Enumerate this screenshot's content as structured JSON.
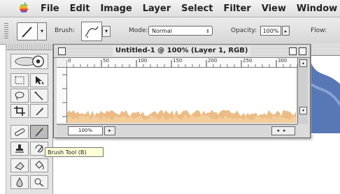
{
  "menubar": {
    "apple_icon": "apple-logo-icon",
    "items": [
      {
        "label": "File"
      },
      {
        "label": "Edit"
      },
      {
        "label": "Image"
      },
      {
        "label": "Layer"
      },
      {
        "label": "Select"
      },
      {
        "label": "Filter"
      },
      {
        "label": "View"
      },
      {
        "label": "Window"
      }
    ]
  },
  "options_bar": {
    "tool_preset_icon": "brush-icon",
    "brush_label": "Brush:",
    "mode_label": "Mode:",
    "mode_value": "Normal",
    "opacity_label": "Opacity:",
    "opacity_value": "100%",
    "flow_label": "Flow:"
  },
  "document": {
    "title": "Untitled-1 @ 100% (Layer 1, RGB)",
    "zoom_value": "100%",
    "ruler_numbers": [
      "0",
      "50",
      "100",
      "150",
      "200",
      "250",
      "300"
    ]
  },
  "tooltip": {
    "text": "Brush Tool (B)"
  },
  "colors": {
    "brush_stroke": "#e8b070",
    "accent_blue": "#3b5fa8"
  }
}
